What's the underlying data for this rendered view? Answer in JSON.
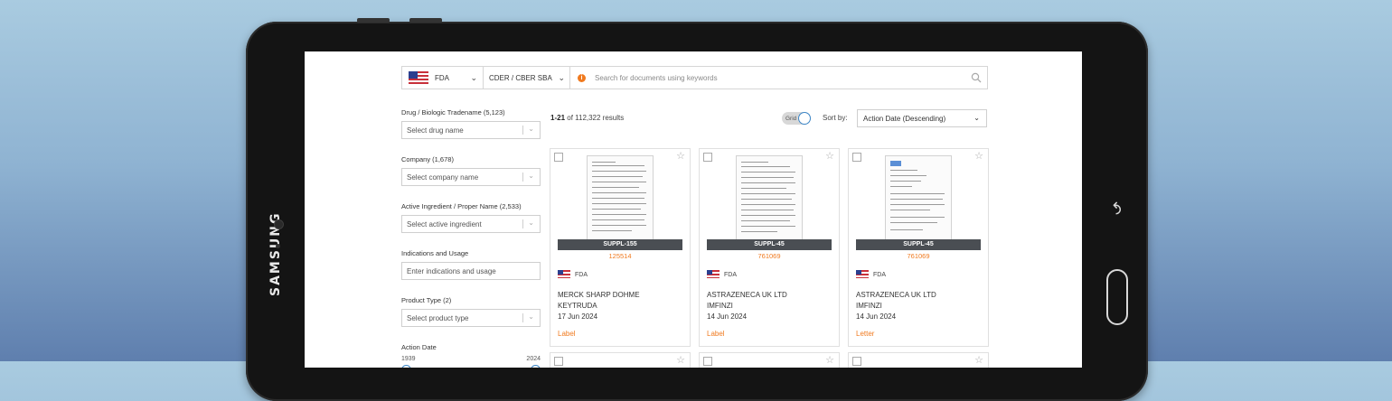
{
  "device": {
    "brand": "SAMSUNG"
  },
  "topbar": {
    "region": "FDA",
    "center": "CDER / CBER SBA",
    "search_placeholder": "Search for documents using keywords"
  },
  "filters": [
    {
      "label": "Drug / Biologic Tradename (5,123)",
      "placeholder": "Select drug name"
    },
    {
      "label": "Company (1,678)",
      "placeholder": "Select company name"
    },
    {
      "label": "Active Ingredient / Proper Name (2,533)",
      "placeholder": "Select active ingredient"
    },
    {
      "label": "Indications and Usage",
      "placeholder": "Enter indications and usage"
    },
    {
      "label": "Product Type (2)",
      "placeholder": "Select product type"
    }
  ],
  "action_date": {
    "label": "Action Date",
    "min": "1939",
    "max": "2024"
  },
  "results": {
    "range": "1-21",
    "rest": " of 112,322 results"
  },
  "view": {
    "grid_label": "Grid"
  },
  "sort": {
    "label": "Sort by:",
    "value": "Action Date (Descending)"
  },
  "cards": [
    {
      "tag": "SUPPL-155",
      "number": "125514",
      "agency": "FDA",
      "company": "MERCK SHARP DOHME",
      "product": "KEYTRUDA",
      "date": "17 Jun 2024",
      "type": "Label"
    },
    {
      "tag": "SUPPL-45",
      "number": "761069",
      "agency": "FDA",
      "company": "ASTRAZENECA UK LTD",
      "product": "IMFINZI",
      "date": "14 Jun 2024",
      "type": "Label"
    },
    {
      "tag": "SUPPL-45",
      "number": "761069",
      "agency": "FDA",
      "company": "ASTRAZENECA UK LTD",
      "product": "IMFINZI",
      "date": "14 Jun 2024",
      "type": "Letter"
    }
  ],
  "colors": {
    "accent": "#f07a1f",
    "tag_bg": "#4a4e53",
    "toggle_blue": "#3d87c8"
  }
}
